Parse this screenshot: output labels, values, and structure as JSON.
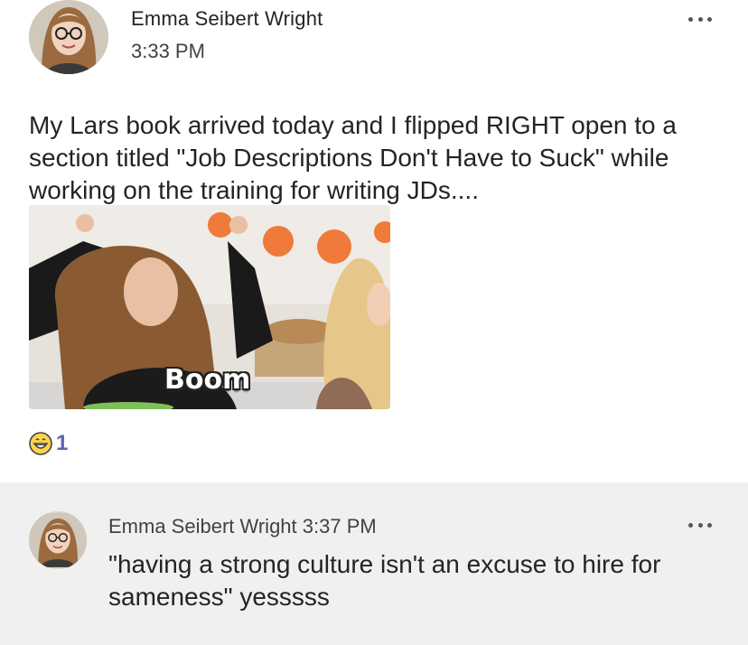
{
  "post": {
    "author": "Emma Seibert Wright",
    "time": "3:33 PM",
    "body": "My Lars book arrived today and I flipped RIGHT open to a section titled \"Job Descriptions Don't Have to Suck\" while working on the training for writing JDs....",
    "gif_caption": "Boom",
    "reaction": {
      "icon": "grinning-emoji-icon",
      "count": "1"
    },
    "more_icon": "more-options-icon"
  },
  "reply": {
    "author": "Emma Seibert Wright",
    "time": "3:37 PM",
    "body": "\"having a strong culture isn't an excuse to hire for sameness\" yesssss",
    "more_icon": "more-options-icon"
  },
  "colors": {
    "accent": "#6264a7",
    "reply_bg": "#f0f0f0",
    "text": "#242424"
  }
}
